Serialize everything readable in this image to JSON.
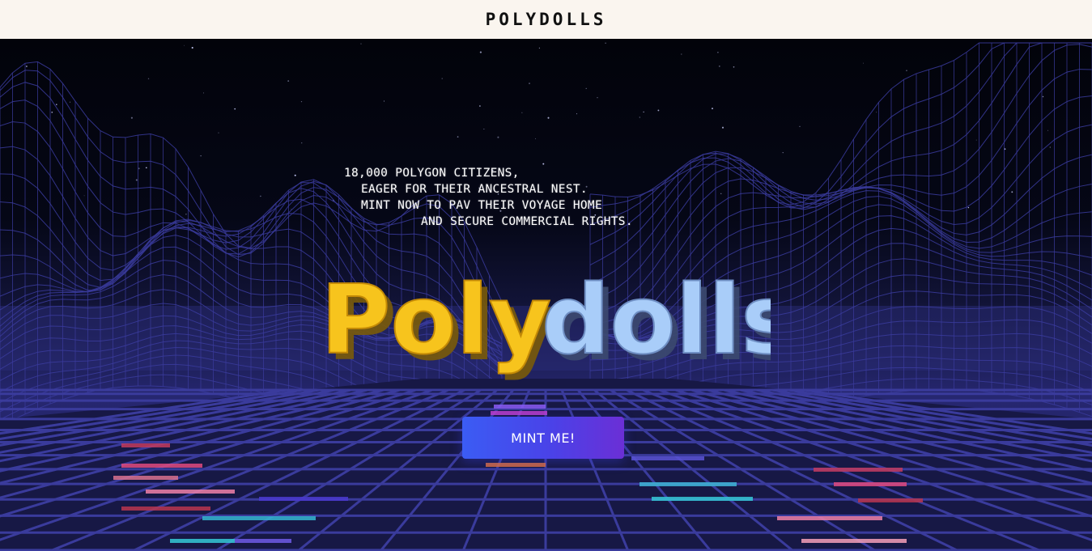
{
  "header": {
    "brand": "POLYDOLLS"
  },
  "hero": {
    "tagline": [
      "18,000 POLYGON CITIZENS,",
      "EAGER FOR THEIR ANCESTRAL NEST.",
      "MINT NOW TO PAV THEIR VOYAGE HOME",
      "AND SECURE COMMERCIAL RIGHTS."
    ],
    "logo": {
      "part1": "Poly",
      "part2": "dolls",
      "color1": "#f7c41d",
      "color2": "#a9cdf9"
    },
    "mint_label": "MINT ME!"
  },
  "colors": {
    "header_bg": "#faf5ef",
    "grid_line": "#3a3b9c",
    "button_start": "#3b5cf4",
    "button_end": "#6b2fd6"
  }
}
